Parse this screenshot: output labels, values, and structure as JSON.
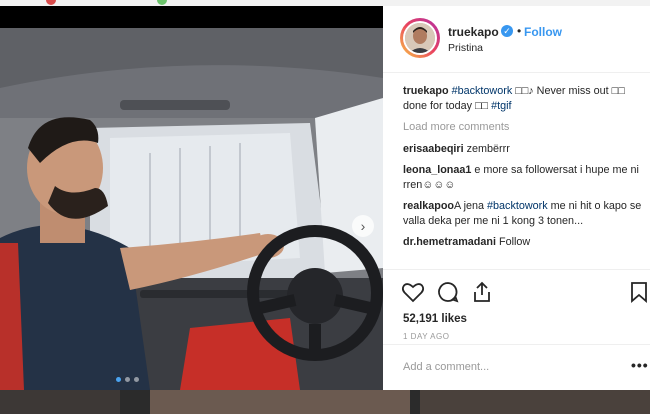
{
  "post": {
    "username": "truekapo",
    "verified_icon": "verified-badge-icon",
    "separator": "•",
    "follow_label": "Follow",
    "location": "Pristina"
  },
  "caption": {
    "username": "truekapo",
    "hashtag1": "#backtowork",
    "text1": "□□♪ Never miss out □□ done for today □□",
    "hashtag2": "#tgif"
  },
  "load_more": "Load more comments",
  "comments": [
    {
      "user": "erisaabeqiri",
      "pre": "",
      "tag": "",
      "post": "zembërrr"
    },
    {
      "user": "leona_lonaa1",
      "pre": "e more sa followersat i hupe me ni rren☺☺☺",
      "tag": "",
      "post": ""
    },
    {
      "user": "realkapoo",
      "pre": "A jena ",
      "tag": "#backtowork",
      "post": " me ni hit o kapo se valla deka per me ni 1 kong 3 tonen..."
    },
    {
      "user": "dr.hemetramadani",
      "pre": "Follow",
      "tag": "",
      "post": ""
    }
  ],
  "actions": {
    "like_icon": "heart-icon",
    "comment_icon": "comment-icon",
    "share_icon": "share-icon",
    "save_icon": "bookmark-icon"
  },
  "likes": "52,191 likes",
  "timestamp": "1 DAY AGO",
  "add_comment_placeholder": "Add a comment...",
  "more_label": "•••",
  "nav_arrow": "›",
  "carousel": {
    "count": 3,
    "active": 1
  }
}
